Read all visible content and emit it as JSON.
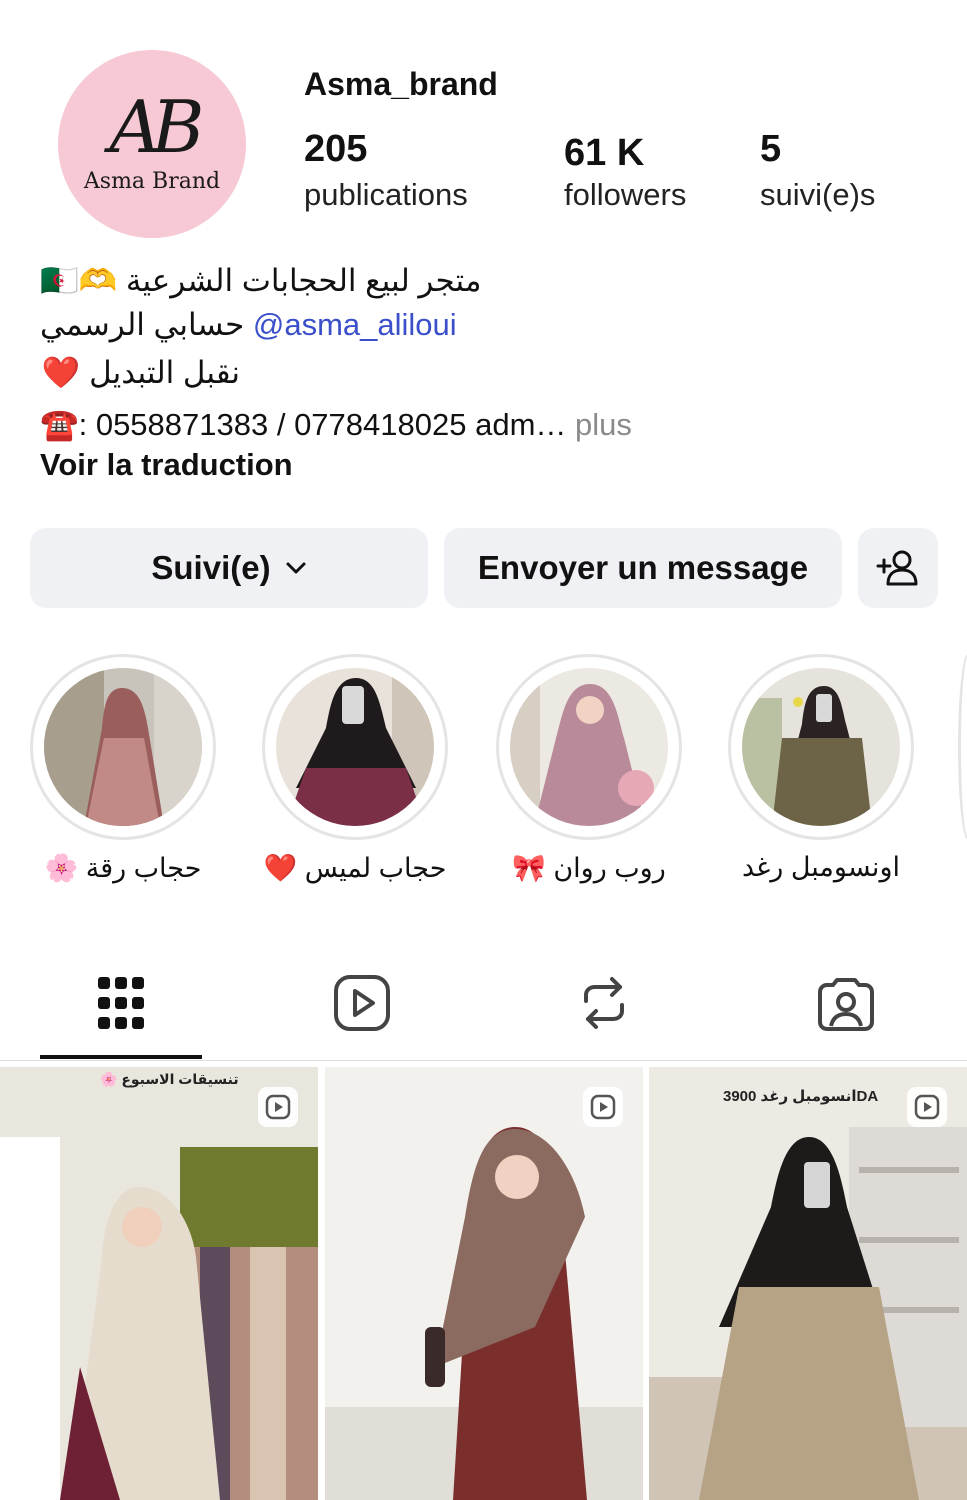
{
  "profile": {
    "username": "Asma_brand",
    "avatar_monogram": "AB",
    "avatar_brand": "Asma Brand",
    "stats": [
      {
        "value": "205",
        "label": "publications"
      },
      {
        "value": "61 K",
        "label": "followers"
      },
      {
        "value": "5",
        "label": "suivi(e)s"
      }
    ]
  },
  "bio": {
    "line1": "متجر لبيع الحجابات الشرعية 🫶🇩🇿",
    "line2_text": "حسابي الرسمي",
    "line2_mention": "@asma_aliloui",
    "line3": "نقبل التبديل ❤️",
    "line4": "☎️: 0558871383 / 0778418025 adm…",
    "more": "plus",
    "translate": "Voir la traduction"
  },
  "actions": {
    "following": "Suivi(e)",
    "message": "Envoyer un message"
  },
  "highlights": [
    {
      "label": "حجاب رقة 🌸"
    },
    {
      "label": "حجاب لميس ❤️"
    },
    {
      "label": "روب روان 🎀"
    },
    {
      "label": "اونسومبل رغد"
    }
  ],
  "tabs": [
    "grid-icon",
    "reels-icon",
    "reposts-icon",
    "tagged-icon"
  ],
  "posts": [
    {
      "caption": "تنسيقات الاسبوع 🌸"
    },
    {
      "caption": ""
    },
    {
      "caption": "انسومبل رغد 3900DA"
    }
  ],
  "colors": {
    "avatar_bg": "#f6c9d4",
    "button_bg": "#eff1f5",
    "mention": "#3a4fc9"
  }
}
